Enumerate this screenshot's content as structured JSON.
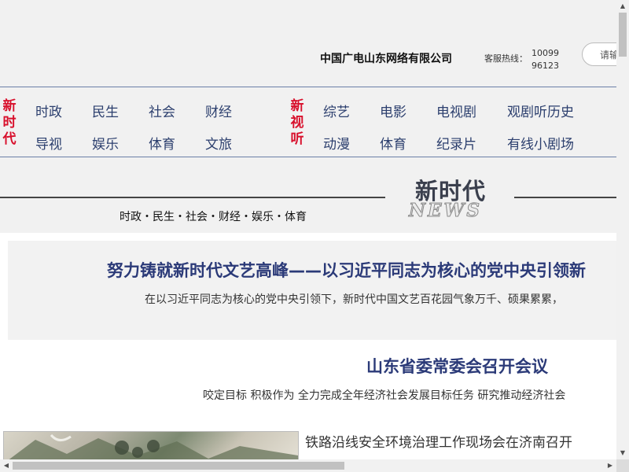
{
  "header": {
    "company": "中国广电山东网络有限公司",
    "hotline_label": "客服热线：",
    "hotline_number": "10099 96123",
    "login_label": "请输"
  },
  "nav": {
    "groups": [
      {
        "title": "新时代",
        "links": [
          "时政",
          "民生",
          "社会",
          "财经",
          "导视",
          "娱乐",
          "体育",
          "文旅"
        ]
      },
      {
        "title": "新视听",
        "links": [
          "综艺",
          "电影",
          "电视剧",
          "观剧听历史",
          "动漫",
          "体育",
          "纪录片",
          "有线小剧场"
        ]
      }
    ]
  },
  "section": {
    "title": "新时代",
    "en_title": "NEWS",
    "subtitle": "时政・民生・社会・财经・娱乐・体育"
  },
  "feature": {
    "title": "努力铸就新时代文艺高峰——以习近平同志为核心的党中央引领新",
    "summary": "在以习近平同志为核心的党中央引领下，新时代中国文艺百花园气象万千、硕果累累，"
  },
  "headline2": {
    "title": "山东省委常委会召开会议",
    "summary": "咬定目标 积极作为 全力完成全年经济社会发展目标任务 研究推动经济社会"
  },
  "news_item": {
    "title": "铁路沿线安全环境治理工作现场会在济南召开"
  },
  "colors": {
    "accent_red": "#d8102c",
    "nav_blue": "#2c3f6e",
    "headline_blue": "#2b3a78"
  }
}
